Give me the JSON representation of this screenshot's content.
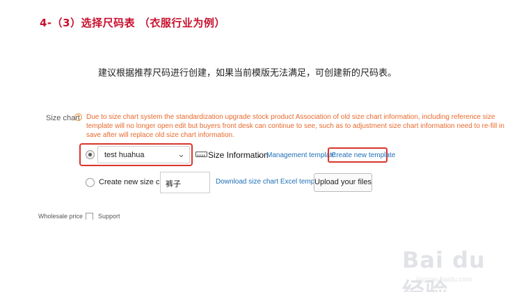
{
  "slide": {
    "title": "4-（3）选择尺码表 （衣服行业为例）",
    "note": "建议根据推荐尺码进行创建，如果当前模版无法满足，可创建新的尺码表。"
  },
  "size_chart": {
    "label": "Size chart",
    "help_icon": "question-circle-icon",
    "warning": "Due to size chart system the standardization upgrade stock product Association of old size chart information, including reference size template will no longer open edit but buyers front desk can continue to see, such as to adjustment size chart information need to re-fill in save after will replace old size chart information.",
    "template_option": {
      "selected": true,
      "select_value": "test huahua",
      "size_information_label": "Size Information",
      "management_template_link": "Management template",
      "create_new_template_link": "Create new template"
    },
    "new_chart_option": {
      "selected": false,
      "label": "Create new size chart",
      "name_value": "裤子",
      "download_link": "Download size chart Excel template",
      "upload_button": "Upload your files"
    },
    "highlight_color": "#d9342b",
    "warning_color": "#e8692c",
    "link_color": "#1f6fb8"
  },
  "wholesale": {
    "label": "Wholesale price",
    "checkbox_label": "Support"
  },
  "watermark": {
    "logo": "Bai du 经验",
    "url": "jingyan.baidu.com"
  }
}
